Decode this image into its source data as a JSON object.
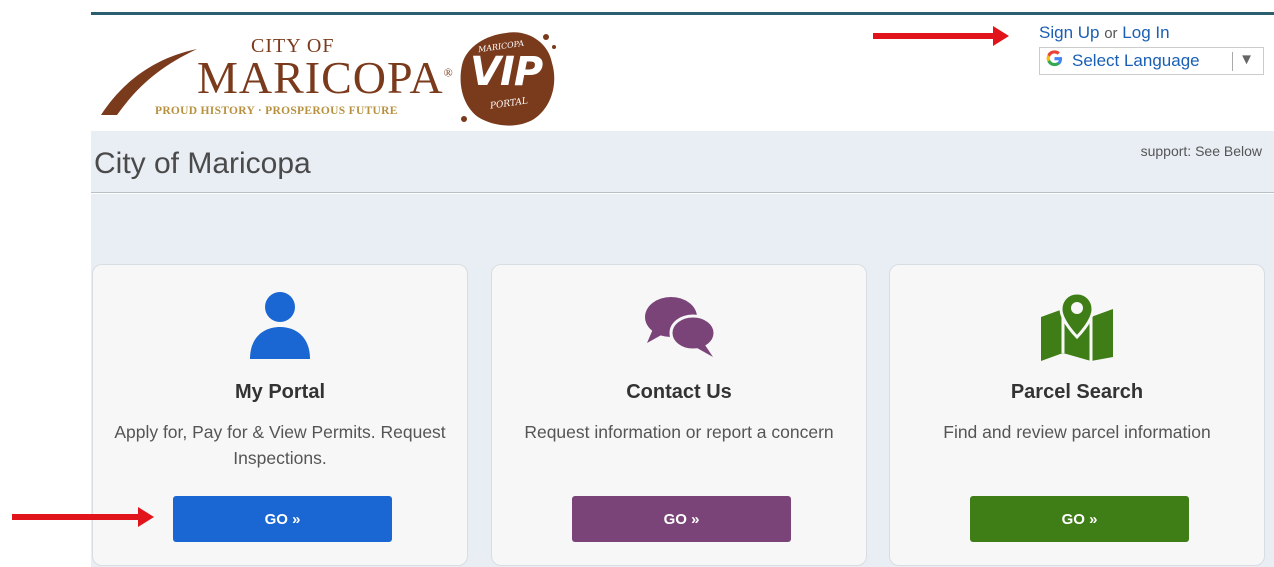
{
  "header": {
    "logo": {
      "city_of": "CITY OF",
      "maricopa": "MARICOPA",
      "tagline": "PROUD HISTORY · PROSPEROUS FUTURE",
      "registered": "®"
    },
    "vip_badge": {
      "top": "MARICOPA",
      "main": "VIP",
      "bottom": "PORTAL"
    },
    "auth": {
      "sign_up": "Sign Up",
      "or": "or",
      "log_in": "Log In"
    },
    "language_select": {
      "icon": "google-g-icon",
      "label": "Select Language",
      "caret": "▼"
    }
  },
  "title_band": {
    "title": "City of Maricopa",
    "support": "support: See Below"
  },
  "cards": [
    {
      "icon": "person-icon",
      "title": "My Portal",
      "description": "Apply for, Pay for & View Permits. Request Inspections.",
      "button": "GO »",
      "color": "#1a66d2"
    },
    {
      "icon": "chat-bubbles-icon",
      "title": "Contact Us",
      "description": "Request information or report a concern",
      "button": "GO »",
      "color": "#7a4478"
    },
    {
      "icon": "map-pin-icon",
      "title": "Parcel Search",
      "description": "Find and review parcel information",
      "button": "GO »",
      "color": "#3f7d16"
    }
  ],
  "colors": {
    "brand_brown": "#7a3a1c",
    "brand_gold": "#b8913f",
    "link_blue": "#1a5fb4",
    "annotation_red": "#e2141b",
    "background": "#e9eef4"
  }
}
